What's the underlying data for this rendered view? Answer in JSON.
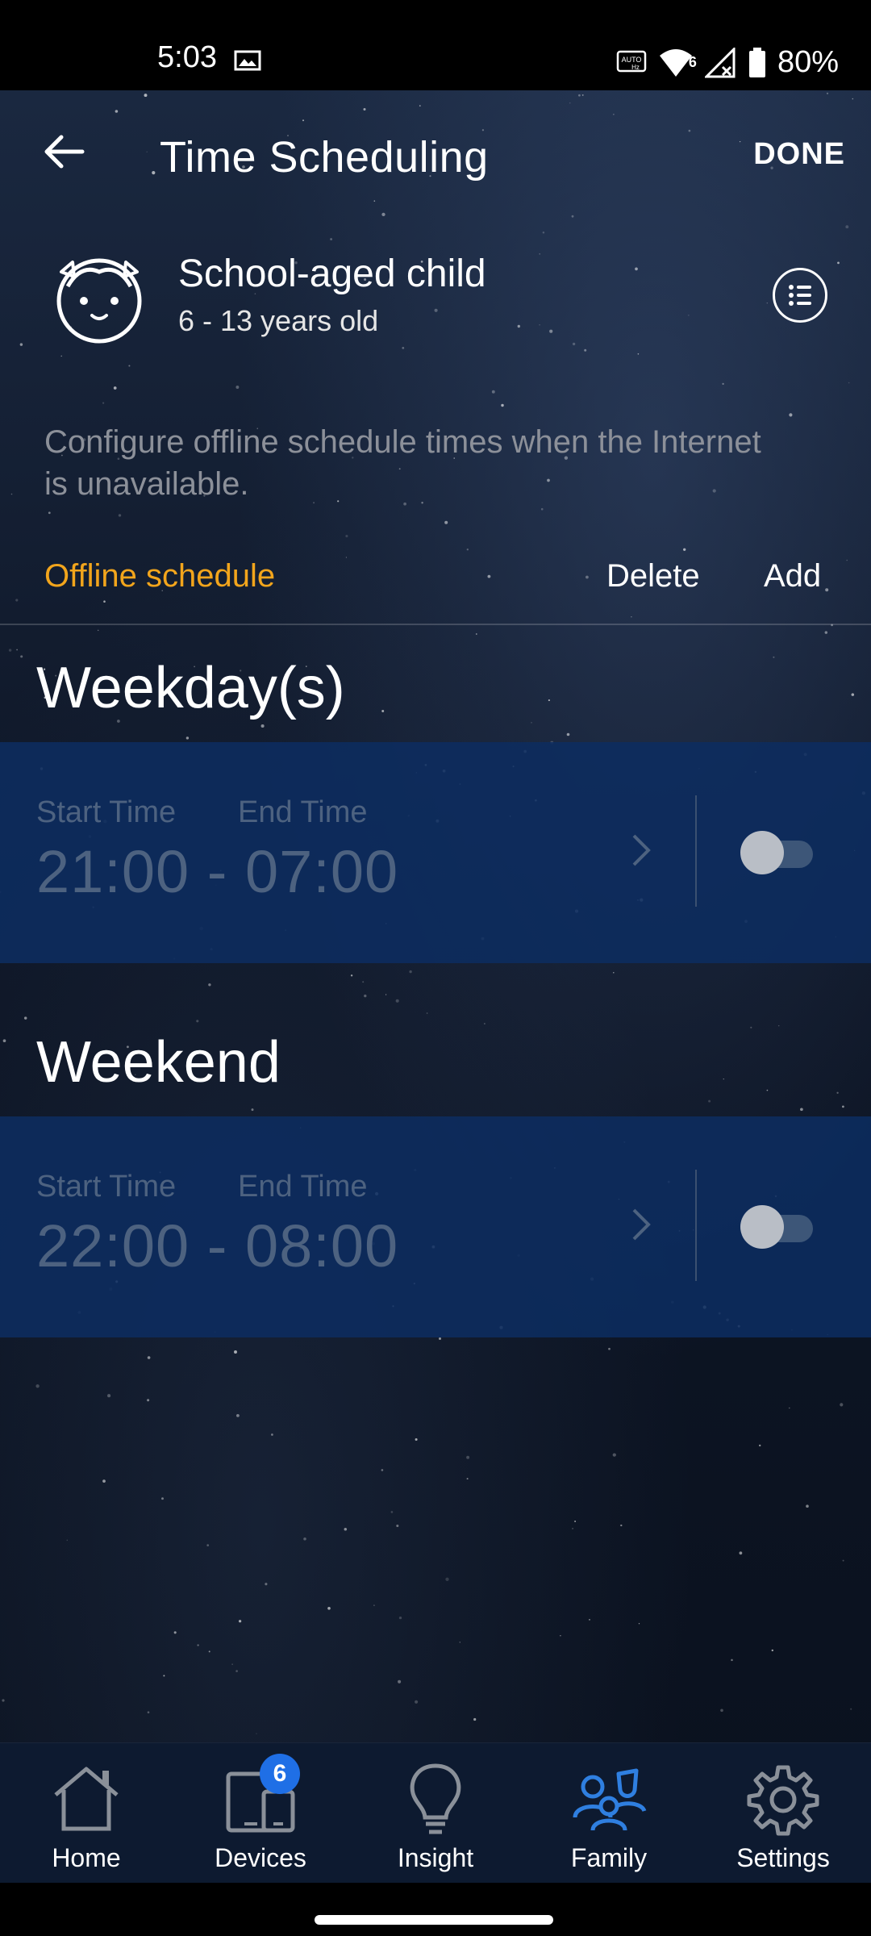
{
  "status_bar": {
    "time": "5:03",
    "battery_percent": "80%",
    "network_badge": "6"
  },
  "header": {
    "title": "Time Scheduling",
    "done_label": "DONE"
  },
  "profile": {
    "name": "School-aged child",
    "age_range": "6 - 13 years old"
  },
  "description": "Configure offline schedule times when the Internet is unavailable.",
  "schedule_bar": {
    "label": "Offline schedule",
    "delete_label": "Delete",
    "add_label": "Add",
    "label_color": "#f2a51c"
  },
  "sections": [
    {
      "title": "Weekday(s)",
      "start_label": "Start Time",
      "end_label": "End Time",
      "time_range": "21:00 - 07:00",
      "enabled": false
    },
    {
      "title": "Weekend",
      "start_label": "Start Time",
      "end_label": "End Time",
      "time_range": "22:00 - 08:00",
      "enabled": false
    }
  ],
  "bottom_nav": {
    "items": [
      {
        "label": "Home",
        "icon": "home-icon",
        "active": false
      },
      {
        "label": "Devices",
        "icon": "devices-icon",
        "active": false,
        "badge": "6"
      },
      {
        "label": "Insight",
        "icon": "lightbulb-icon",
        "active": false
      },
      {
        "label": "Family",
        "icon": "family-icon",
        "active": true
      },
      {
        "label": "Settings",
        "icon": "gear-icon",
        "active": false
      }
    ],
    "active_color": "#2f7fe0"
  }
}
